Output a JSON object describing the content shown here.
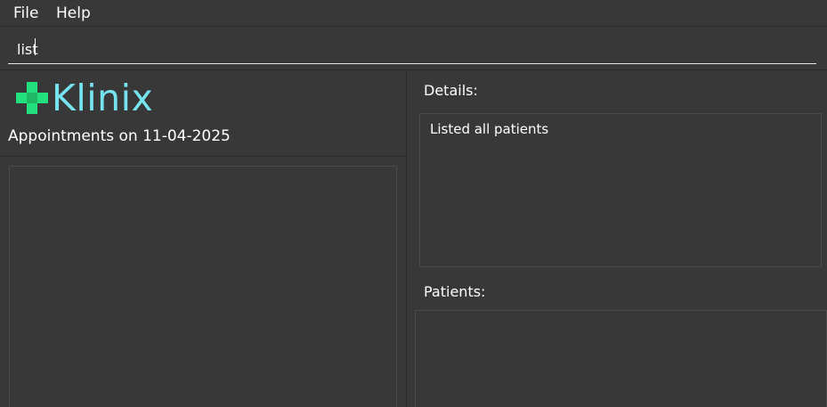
{
  "menu": {
    "file": "File",
    "help": "Help"
  },
  "command": {
    "value": "list"
  },
  "logo": {
    "text": "Klinix"
  },
  "appointments": {
    "title": "Appointments on 11-04-2025",
    "items": []
  },
  "details": {
    "label": "Details:",
    "message": "Listed all patients"
  },
  "patients": {
    "label": "Patients:",
    "items": []
  },
  "colors": {
    "background": "#383838",
    "logo_cross": "#23e07e",
    "logo_text": "#76e4ee"
  }
}
